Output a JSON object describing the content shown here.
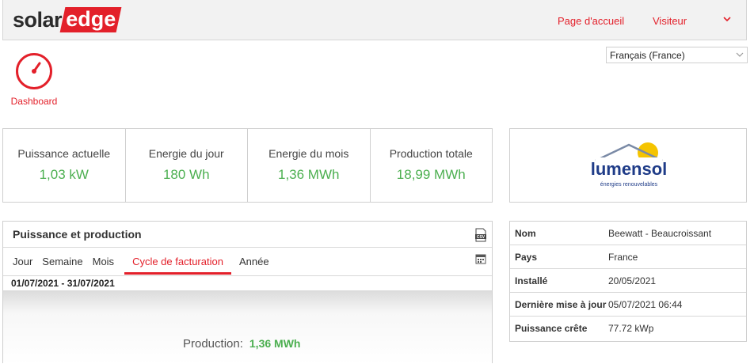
{
  "header": {
    "logo_solar": "solar",
    "logo_edge": "edge",
    "nav_home": "Page d'accueil",
    "nav_visitor": "Visiteur",
    "chevron_icon": "chevron-down-icon"
  },
  "dashboard": {
    "icon": "speedometer-icon",
    "label": "Dashboard"
  },
  "language": {
    "selected": "Français (France)"
  },
  "stats": [
    {
      "label": "Puissance actuelle",
      "value": "1,03 kW"
    },
    {
      "label": "Energie du jour",
      "value": "180 Wh"
    },
    {
      "label": "Energie du mois",
      "value": "1,36 MWh"
    },
    {
      "label": "Production totale",
      "value": "18,99 MWh"
    }
  ],
  "partner": {
    "logo_text": "lumensol",
    "logo_tagline": "énergies renouvelables"
  },
  "production_panel": {
    "title": "Puissance et production",
    "csv_icon": "csv-export-icon",
    "calendar_icon": "calendar-icon",
    "tabs": [
      "Jour",
      "Semaine",
      "Mois",
      "Cycle de facturation",
      "Année"
    ],
    "active_tab": "Cycle de facturation",
    "date_range": "01/07/2021 - 31/07/2021",
    "production_label": "Production:",
    "production_value": "1,36 MWh"
  },
  "site_info": [
    {
      "key": "Nom",
      "value": "Beewatt - Beaucroissant"
    },
    {
      "key": "Pays",
      "value": "France"
    },
    {
      "key": "Installé",
      "value": "20/05/2021"
    },
    {
      "key": "Dernière mise à jour",
      "value": "05/07/2021 06:44"
    },
    {
      "key": "Puissance crête",
      "value": "77.72 kWp"
    }
  ],
  "colors": {
    "brand_red": "#e3202a",
    "value_green": "#4caf50"
  }
}
